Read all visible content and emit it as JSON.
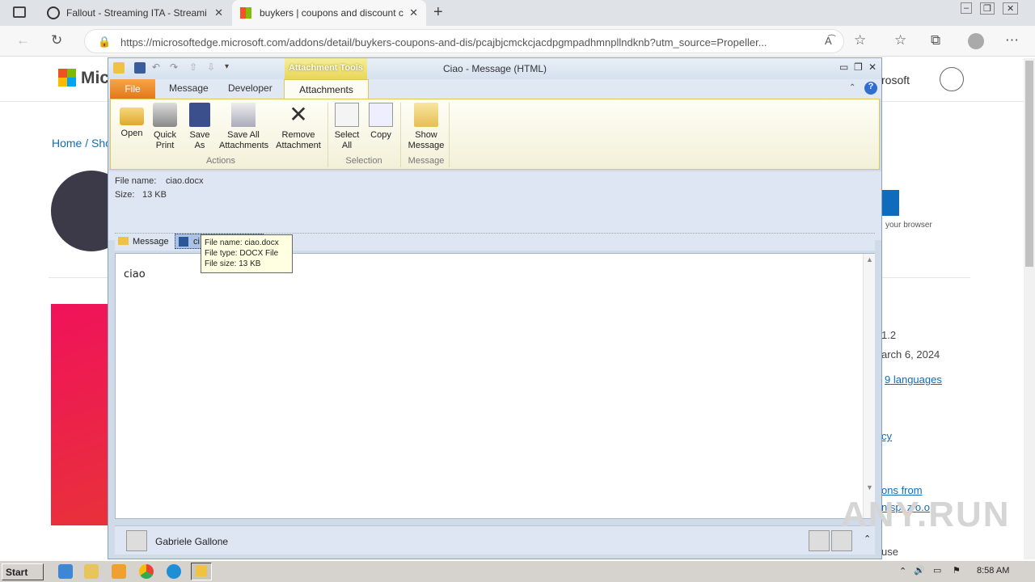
{
  "browser": {
    "tabs": [
      {
        "label": "Fallout - Streaming ITA - Streami"
      },
      {
        "label": "buykers | coupons and discount c"
      }
    ],
    "url": "https://microsoftedge.microsoft.com/addons/detail/buykers-coupons-and-dis/pcajbjcmckcjacdpgmpadhmnpllndknb?utm_source=Propeller..."
  },
  "page": {
    "logo_text": "Mic",
    "header_right": "rosoft",
    "breadcrumb": "Home / Sho",
    "version": "1.2",
    "date": "arch 6, 2024",
    "languages": "9 languages",
    "browser_note": "your browser",
    "policy": "cy",
    "more_from": "ons from",
    "company": "n sp. z o.o",
    "use": "use"
  },
  "outlook": {
    "title": "Ciao  -  Message (HTML)",
    "contextual_tab": "Attachment Tools",
    "tabs": [
      "File",
      "Message",
      "Developer",
      "Attachments"
    ],
    "ribbon": {
      "open": "Open",
      "quick_print": "Quick Print",
      "save_as": "Save As",
      "save_all": "Save All Attachments",
      "remove": "Remove Attachment",
      "select_all": "Select All",
      "copy": "Copy",
      "show_message": "Show Message",
      "group_actions": "Actions",
      "group_selection": "Selection",
      "group_message": "Message"
    },
    "info": {
      "file_name_label": "File name:",
      "file_name": "ciao.docx",
      "size_label": "Size:",
      "size": "13 KB"
    },
    "attachment_bar": {
      "message": "Message",
      "attachment": "ci"
    },
    "tooltip": {
      "line1": "File name:  ciao.docx",
      "line2": "File type:  DOCX File",
      "line3": "File size:  13 KB"
    },
    "body_text": "ciao",
    "sender": "Gabriele Gallone"
  },
  "taskbar": {
    "start": "Start",
    "time": "8:58 AM"
  },
  "watermark": "ANY.RUN"
}
